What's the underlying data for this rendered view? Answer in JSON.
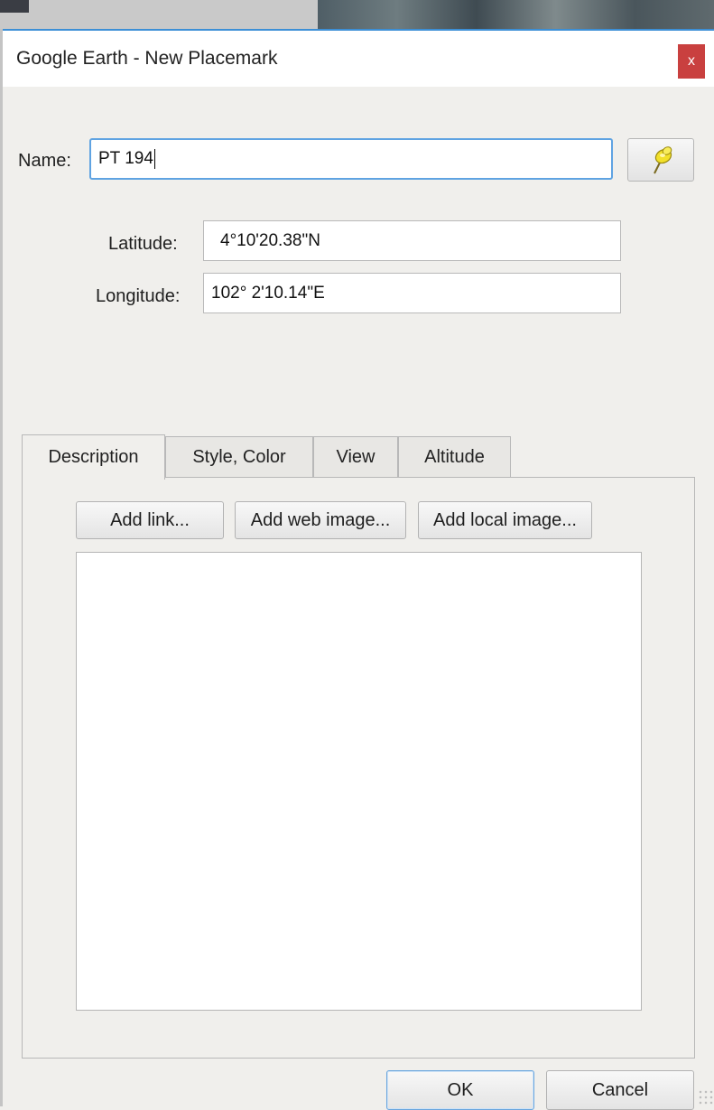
{
  "window": {
    "title": "Google Earth - New Placemark",
    "close_label": "x"
  },
  "fields": {
    "name_label": "Name:",
    "name_value": "PT 194",
    "latitude_label": "Latitude:",
    "latitude_value": "4°10'20.38\"N",
    "longitude_label": "Longitude:",
    "longitude_value": "102° 2'10.14\"E"
  },
  "tabs": [
    {
      "label": "Description",
      "active": true
    },
    {
      "label": "Style, Color",
      "active": false
    },
    {
      "label": "View",
      "active": false
    },
    {
      "label": "Altitude",
      "active": false
    }
  ],
  "description": {
    "add_link_label": "Add link...",
    "add_web_image_label": "Add web image...",
    "add_local_image_label": "Add local image...",
    "text": ""
  },
  "footer": {
    "ok_label": "OK",
    "cancel_label": "Cancel"
  },
  "icons": {
    "placemark": "yellow-pushpin-icon",
    "close": "close-icon"
  },
  "colors": {
    "close_button": "#c9403f",
    "focus_border": "#5fa3e2",
    "pin_yellow": "#f2e02a"
  }
}
